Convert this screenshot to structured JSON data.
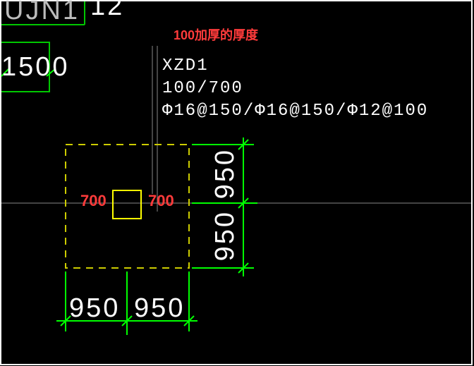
{
  "annotation_red": {
    "thickness_note": "100加厚的厚度"
  },
  "spec_block": {
    "name": "XZD1",
    "size": "100/700",
    "rebar": "Φ16@150/Φ16@150/Φ12@100"
  },
  "inner_dims": {
    "left": "700",
    "right": "700"
  },
  "dims_right": {
    "upper": "950",
    "lower": "950"
  },
  "dims_bottom": {
    "left": "950",
    "right": "950"
  },
  "top_dims": {
    "left_big": "1500",
    "top_small": "12",
    "corner_label": "UJN1"
  }
}
